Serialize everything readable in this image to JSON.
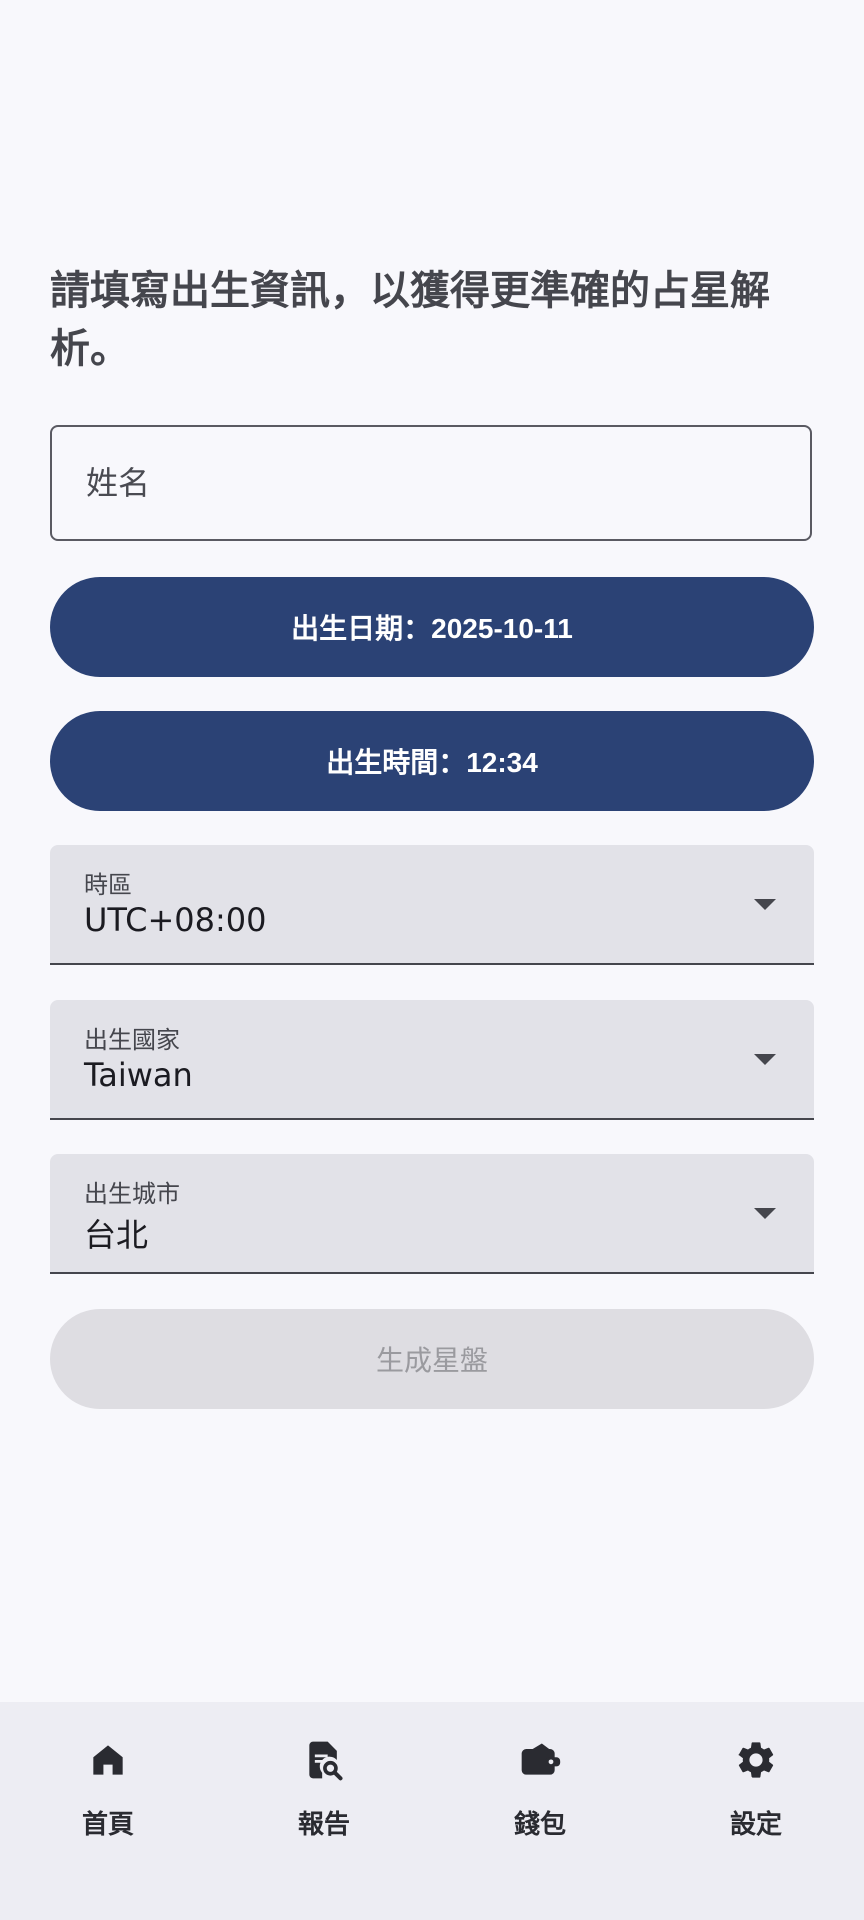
{
  "intro_text": "請填寫出生資訊，以獲得更準確的占星解析。",
  "form": {
    "name_placeholder": "姓名",
    "birth_date_button": "出生日期：2025-10-11",
    "birth_time_button": "出生時間：12:34",
    "timezone": {
      "label": "時區",
      "value": "UTC+08:00"
    },
    "country": {
      "label": "出生國家",
      "value": "Taiwan"
    },
    "city": {
      "label": "出生城市",
      "value": "台北"
    },
    "generate_button": "生成星盤"
  },
  "nav": {
    "items": [
      {
        "label": "首頁",
        "icon": "home-icon"
      },
      {
        "label": "報告",
        "icon": "report-search-icon"
      },
      {
        "label": "錢包",
        "icon": "wallet-icon"
      },
      {
        "label": "設定",
        "icon": "gear-icon"
      }
    ]
  },
  "colors": {
    "primary": "#2b4275",
    "background": "#f8f8fc",
    "nav_background": "#ededf3",
    "disabled_button": "#dedde2"
  }
}
